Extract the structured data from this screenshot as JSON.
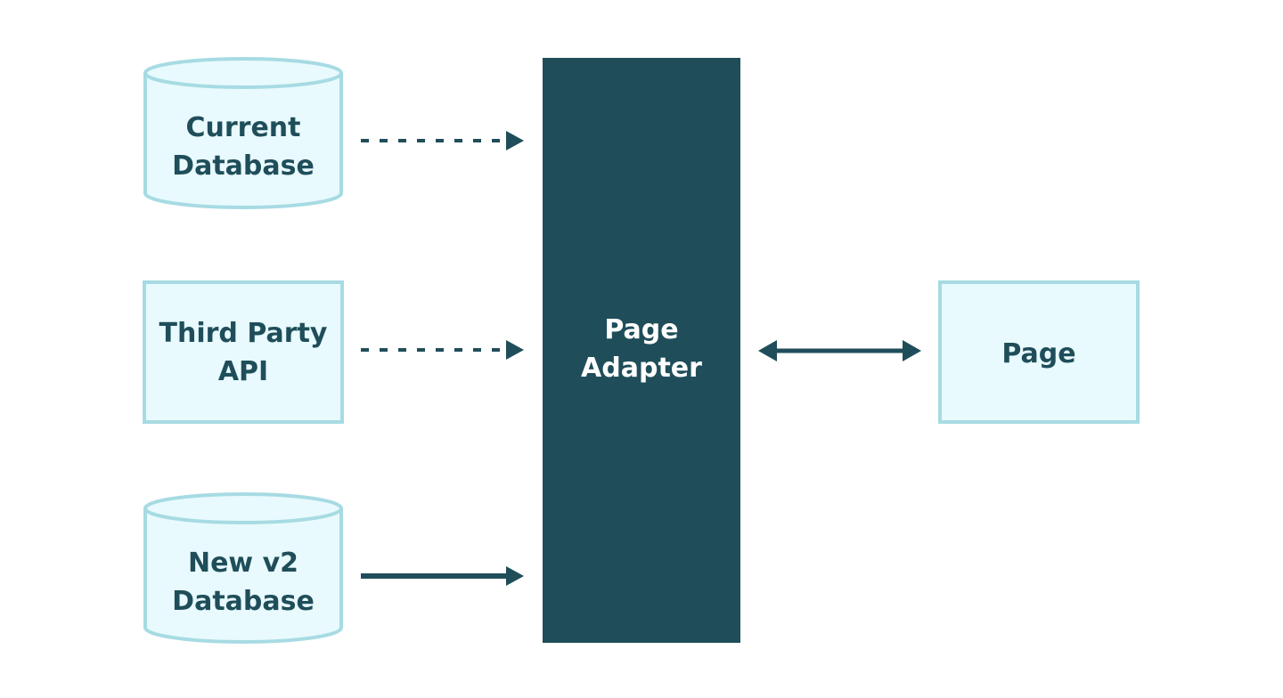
{
  "colors": {
    "node_fill": "#e8fafd",
    "node_stroke": "#a7dbe3",
    "adapter_fill": "#1f4e5a",
    "text_dark": "#1f4e5a",
    "text_light": "#ffffff",
    "arrow": "#1f4e5a"
  },
  "nodes": {
    "current_db": {
      "line1": "Current",
      "line2": "Database",
      "shape": "cylinder"
    },
    "third_party": {
      "line1": "Third Party",
      "line2": "API",
      "shape": "rectangle"
    },
    "new_db": {
      "line1": "New v2",
      "line2": "Database",
      "shape": "cylinder"
    },
    "adapter": {
      "line1": "Page",
      "line2": "Adapter",
      "shape": "rectangle"
    },
    "page": {
      "label": "Page",
      "shape": "rectangle"
    }
  },
  "edges": [
    {
      "from": "Current Database",
      "to": "Page Adapter",
      "style": "dashed",
      "direction": "forward"
    },
    {
      "from": "Third Party API",
      "to": "Page Adapter",
      "style": "dashed",
      "direction": "forward"
    },
    {
      "from": "New v2 Database",
      "to": "Page Adapter",
      "style": "solid",
      "direction": "forward"
    },
    {
      "from": "Page Adapter",
      "to": "Page",
      "style": "solid",
      "direction": "bidirectional"
    }
  ]
}
